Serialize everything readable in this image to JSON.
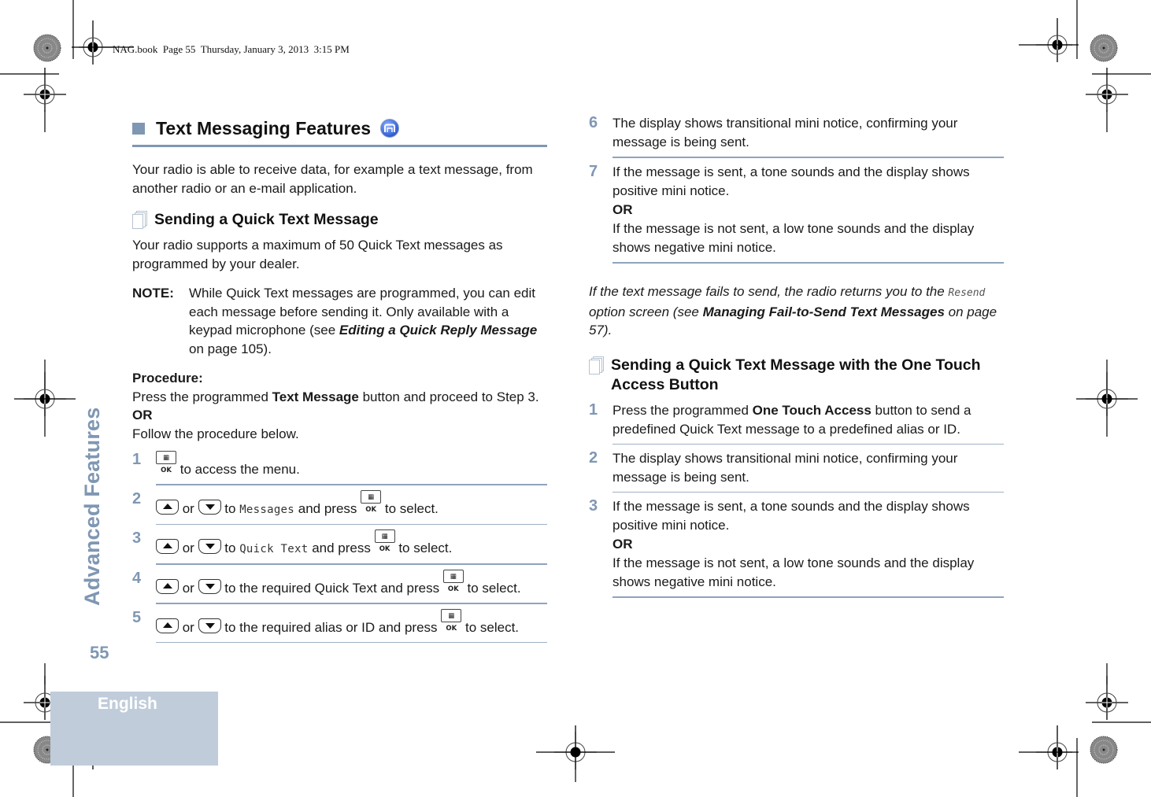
{
  "header": {
    "slug": "NAG.book  Page 55  Thursday, January 3, 2013  3:15 PM"
  },
  "side": {
    "section_title": "Advanced Features",
    "page_number": "55",
    "language": "English"
  },
  "colors": {
    "accent": "#7f97b3",
    "language_tab": "#c0ccda"
  },
  "icons": {
    "heading_bullet": "square-bullet",
    "feature_icon": "digital-mode-icon",
    "subheading_icon": "pages-icon",
    "menu_ok_key": "menu-ok-key",
    "up_key": "up-arrow-key",
    "down_key": "down-arrow-key"
  },
  "left": {
    "title": "Text Messaging Features",
    "intro": "Your radio is able to receive data, for example a text message, from another radio or an e-mail application.",
    "sub1_title": "Sending a Quick Text Message",
    "sub1_intro": "Your radio supports a maximum of 50 Quick Text messages as programmed by your dealer.",
    "note": {
      "label": "NOTE:",
      "text_a": "While Quick Text messages are programmed, you can edit each message before sending it. Only available with a keypad microphone (see ",
      "link": "Editing a Quick Reply Message",
      "text_b": " on page 105)."
    },
    "procedure": {
      "label": "Procedure:",
      "line1_a": "Press the programmed ",
      "line1_bold": "Text Message",
      "line1_b": " button and proceed to Step 3.",
      "or": "OR",
      "line2": "Follow the procedure below."
    },
    "ok_key_label": "OK",
    "or_word": " or ",
    "steps": [
      {
        "num": "1",
        "text": " to access the menu."
      },
      {
        "num": "2",
        "pre": " to ",
        "menu": "Messages",
        "post": " and press ",
        "tail": " to select."
      },
      {
        "num": "3",
        "pre": " to ",
        "menu": "Quick Text",
        "post": " and press ",
        "tail": " to select."
      },
      {
        "num": "4",
        "pre": " to the required Quick Text and press ",
        "tail": " to select."
      },
      {
        "num": "5",
        "pre": " to the required alias or ID and press ",
        "tail": " to select."
      }
    ]
  },
  "right": {
    "steps_a": [
      {
        "num": "6",
        "text": "The display shows transitional mini notice, confirming your message is being sent."
      },
      {
        "num": "7",
        "text1": "If the message is sent, a tone sounds and the display shows positive mini notice.",
        "or": "OR",
        "text2": "If the message is not sent, a low tone sounds and the display shows negative mini notice."
      }
    ],
    "fail_note": {
      "a": "If the text message fails to send, the radio returns you to the ",
      "menu": "Resend",
      "b": " option screen (see ",
      "link": "Managing Fail-to-Send Text Messages",
      "c": " on page 57)."
    },
    "sub2_title": "Sending a Quick Text Message with the One Touch Access Button",
    "steps_b": [
      {
        "num": "1",
        "a": "Press the programmed ",
        "bold": "One Touch Access",
        "b": " button to send a predefined Quick Text message to a predefined alias or ID."
      },
      {
        "num": "2",
        "text": "The display shows transitional mini notice, confirming your message is being sent."
      },
      {
        "num": "3",
        "text1": "If the message is sent, a tone sounds and the display shows positive mini notice.",
        "or": "OR",
        "text2": "If the message is not sent, a low tone sounds and the display shows negative mini notice."
      }
    ]
  }
}
